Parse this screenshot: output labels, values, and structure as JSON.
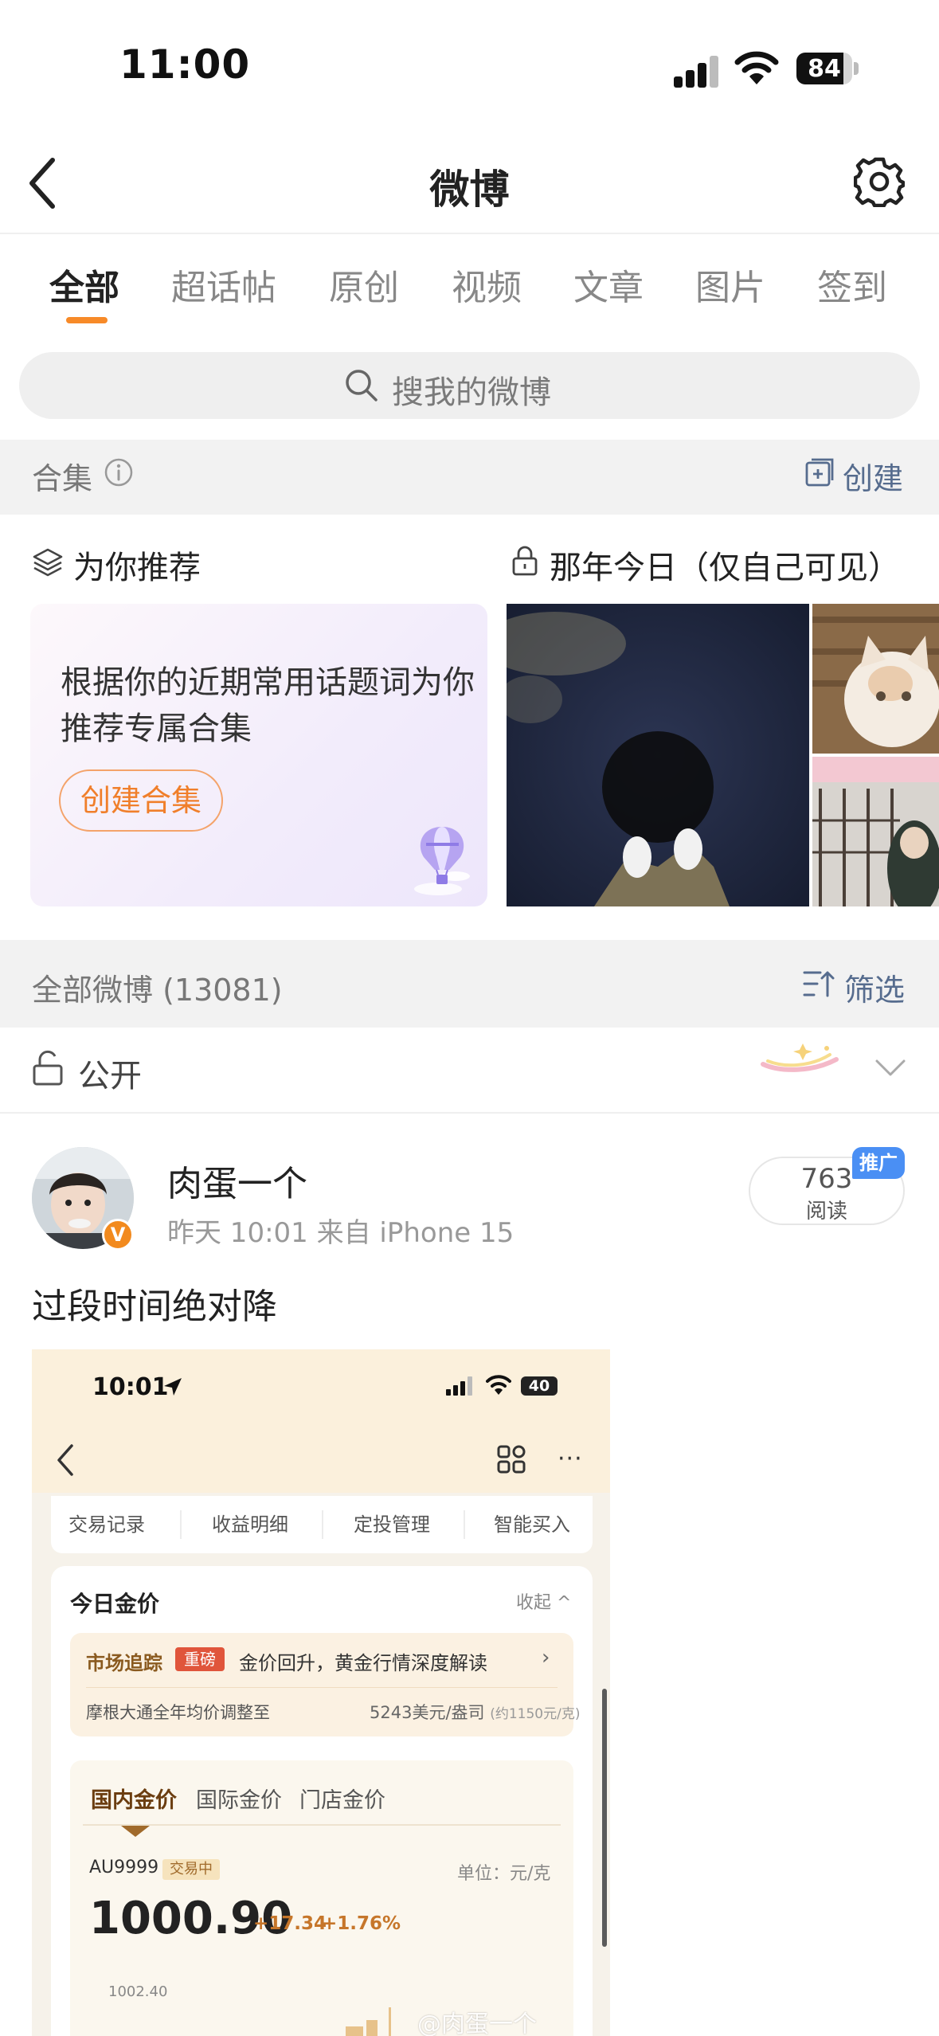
{
  "status_bar": {
    "time": "11:00",
    "battery": "84"
  },
  "nav": {
    "title": "微博"
  },
  "tabs": [
    {
      "label": "全部",
      "active": true
    },
    {
      "label": "超话帖"
    },
    {
      "label": "原创"
    },
    {
      "label": "视频"
    },
    {
      "label": "文章"
    },
    {
      "label": "图片"
    },
    {
      "label": "签到"
    }
  ],
  "search": {
    "placeholder": "搜我的微博"
  },
  "collection": {
    "label": "合集",
    "create_label": "创建",
    "recommend_title": "为你推荐",
    "recommend_text": "根据你的近期常用话题词为你推荐专属合集",
    "create_collection_button": "创建合集",
    "memory_title": "那年今日（仅自己可见）"
  },
  "all_weibo": {
    "label": "全部微博 (13081)",
    "filter_label": "筛选"
  },
  "visibility": {
    "label": "公开"
  },
  "post": {
    "author": "肉蛋一个",
    "meta": "昨天 10:01  来自 iPhone 15",
    "read_count": "763",
    "read_label": "阅读",
    "promo_badge": "推广",
    "text": "过段时间绝对降",
    "verified_mark": "V"
  },
  "embedded": {
    "time": "10:01",
    "battery": "40",
    "more": "···",
    "subnav": [
      "交易记录",
      "收益明细",
      "定投管理",
      "智能买入"
    ],
    "card_title": "今日金价",
    "collapse": "收起 ^",
    "news_tag": "市场追踪",
    "news_badge": "重磅",
    "news_text": "金价回升，黄金行情深度解读",
    "news_chevron": "›",
    "news_sub": "摩根大通全年均价调整至",
    "news_val": "5243美元/盎司",
    "news_val_note": "(约1150元/克)",
    "price_tabs": [
      "国内金价",
      "国际金价",
      "门店金价"
    ],
    "code": "AU9999",
    "trading": "交易中",
    "unit": "单位：元/克",
    "price": "1000.90",
    "change": "+17.34",
    "pct": "+1.76%",
    "axis_top": "1002.40",
    "watermark": "@肉蛋一个"
  },
  "colors": {
    "accent": "#f78a28",
    "link": "#566c8e",
    "promo": "#4a8ff4"
  }
}
